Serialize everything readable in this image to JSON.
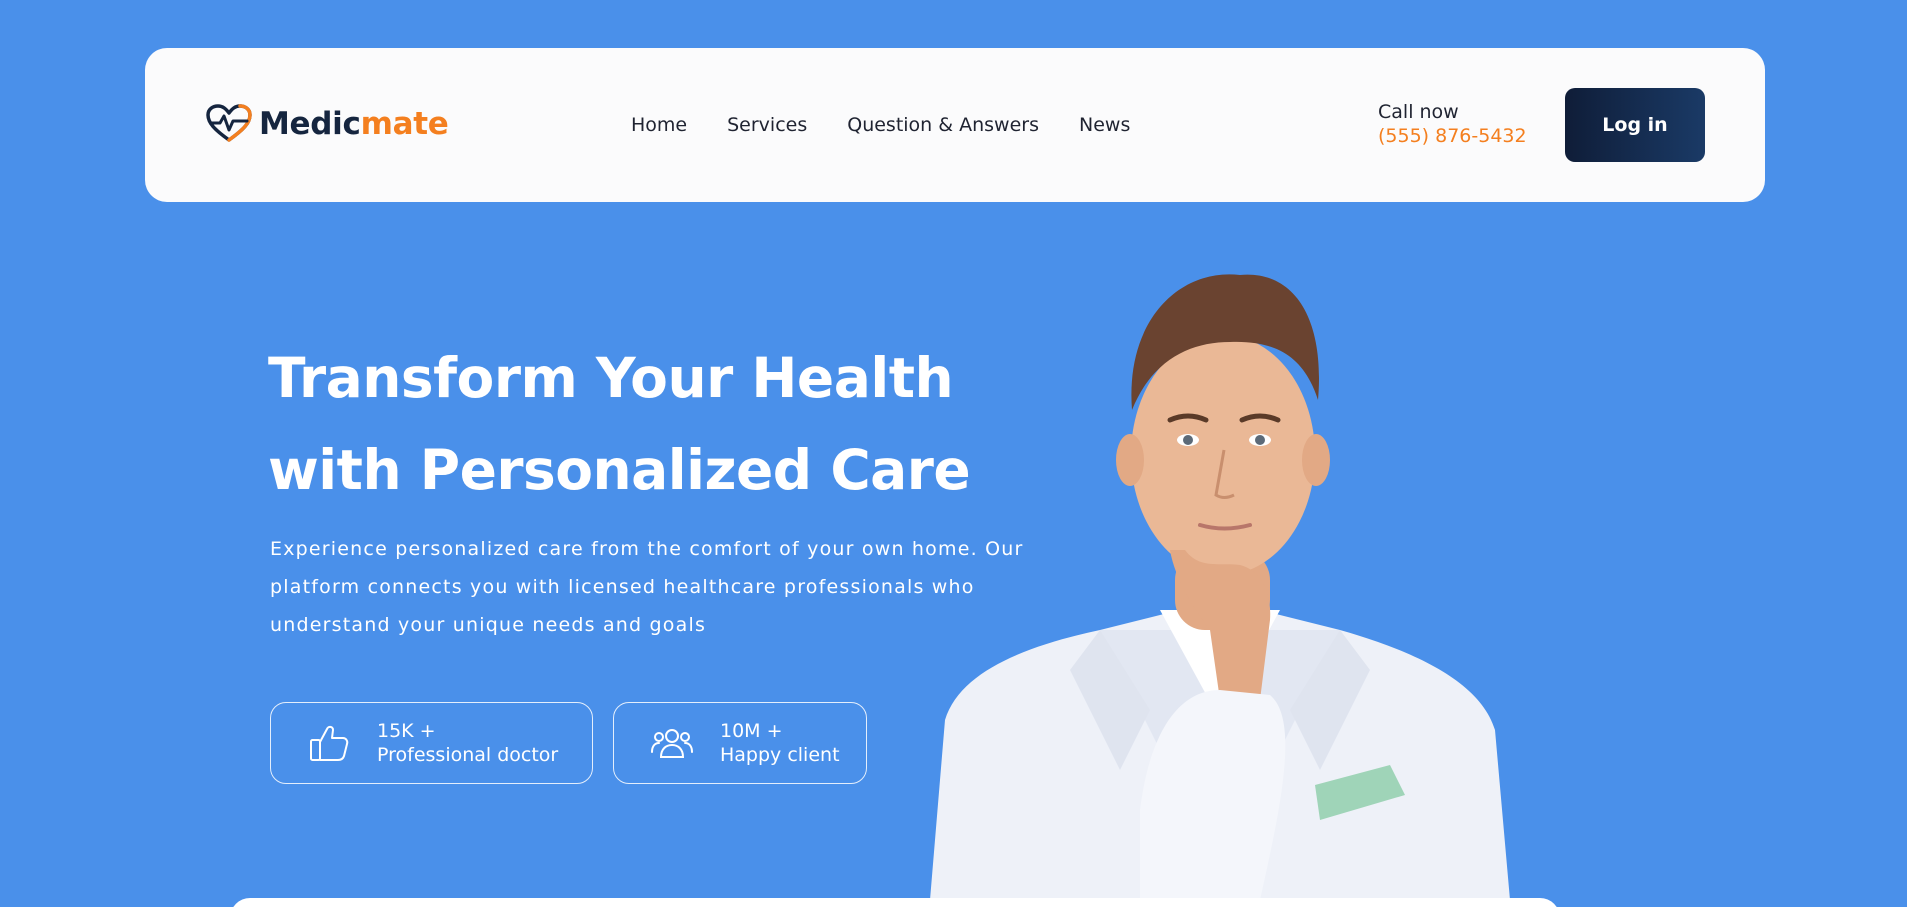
{
  "brand": {
    "name_part1": "Medic",
    "name_part2": "mate",
    "logo_icon": "heart-pulse-icon",
    "colors": {
      "dark": "#15253f",
      "accent": "#f47f1f"
    }
  },
  "nav": {
    "items": [
      {
        "label": "Home"
      },
      {
        "label": "Services"
      },
      {
        "label": "Question & Answers"
      },
      {
        "label": "News"
      }
    ]
  },
  "contact": {
    "label": "Call now",
    "phone": "(555) 876-5432"
  },
  "header_actions": {
    "login_label": "Log in"
  },
  "hero": {
    "title_line1": "Transform Your Health",
    "title_line2": "with Personalized Care",
    "description": "Experience personalized care from the comfort of your own home. Our platform connects you with licensed healthcare professionals who understand your unique needs and goals",
    "background_color": "#4a90ea"
  },
  "stats": [
    {
      "icon": "thumbs-up-icon",
      "value": "15K +",
      "label": "Professional doctor"
    },
    {
      "icon": "users-icon",
      "value": "10M +",
      "label": "Happy client"
    }
  ]
}
